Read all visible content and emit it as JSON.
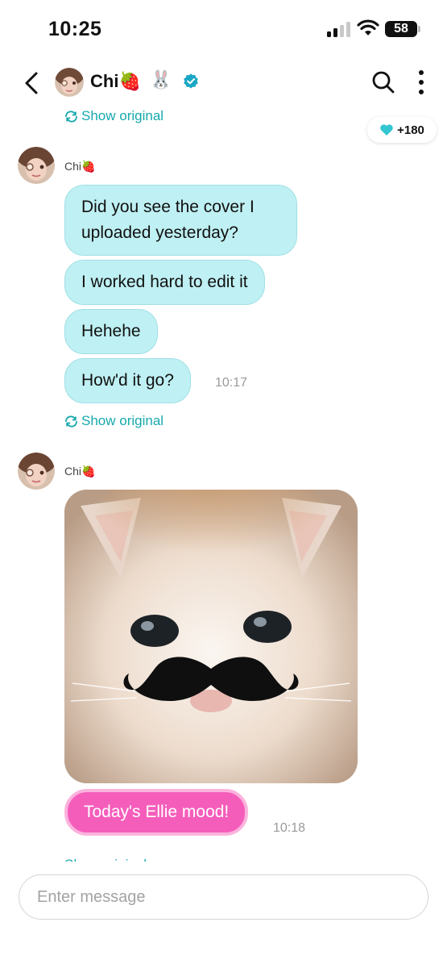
{
  "status_bar": {
    "time": "10:25",
    "battery": "58"
  },
  "header": {
    "name": "Chi",
    "name_emoji": "🍓",
    "bunny_emoji": "🐰",
    "likes": "+180"
  },
  "translation": {
    "show_original": "Show original"
  },
  "thread": {
    "group1": {
      "sender": "Chi",
      "sender_emoji": "🍓",
      "messages": [
        {
          "text": "Did you see the cover I uploaded yesterday?"
        },
        {
          "text": "I worked hard to edit it"
        },
        {
          "text": "Hehehe"
        },
        {
          "text": "How'd it go?"
        }
      ],
      "time": "10:17"
    },
    "group2": {
      "sender": "Chi",
      "sender_emoji": "🍓",
      "image_icon": "cat-with-mustache-photo",
      "caption": "Today's Ellie mood!",
      "time": "10:18"
    }
  },
  "composer": {
    "placeholder": "Enter message"
  },
  "colors": {
    "accent": "#17a9ad",
    "bubble": "#bff0f3",
    "pink": "#f55dbb",
    "verified": "#1aa6c4"
  }
}
